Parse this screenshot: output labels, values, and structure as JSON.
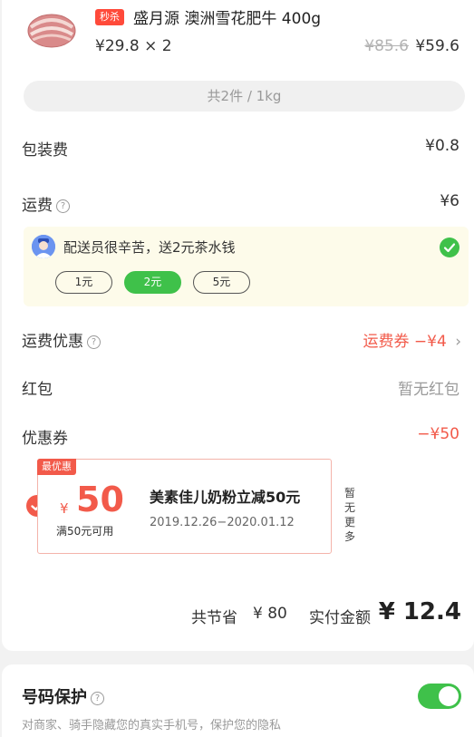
{
  "product": {
    "flash_tag": "秒杀",
    "name": "盛月源 澳洲雪花肥牛 400g",
    "unit_price": "¥29.8 × 2",
    "original_price": "¥85.6",
    "price": "¥59.6",
    "image_icon": "sliced-beef-image"
  },
  "summary": "共2件 / 1kg",
  "fees": {
    "packaging_label": "包装费",
    "packaging_value": "¥0.8",
    "delivery_label": "运费",
    "delivery_value": "¥6"
  },
  "tip": {
    "text": "配送员很辛苦，送2元茶水钱",
    "options": [
      "1元",
      "2元",
      "5元"
    ],
    "selected": "2元"
  },
  "delivery_discount": {
    "label": "运费优惠",
    "value": "运费券 −¥4"
  },
  "red_packet": {
    "label": "红包",
    "value": "暂无红包"
  },
  "coupon_row": {
    "label": "优惠券",
    "value": "−¥50"
  },
  "coupon": {
    "tag": "最优惠",
    "currency": "¥",
    "amount": "50",
    "condition": "满50元可用",
    "title": "美素佳儿奶粉立减50元",
    "dates": "2019.12.26−2020.01.12",
    "side_note": "暂无更多"
  },
  "footer": {
    "saved_label": "共节省",
    "saved_value": "¥ 80",
    "paid_label": "实付金额",
    "paid_value": "¥ 12.4"
  },
  "privacy": {
    "title": "号码保护",
    "desc": "对商家、骑手隐藏您的真实手机号，保护您的隐私",
    "enabled": true
  },
  "colors": {
    "accent_red": "#f25a4a",
    "accent_green": "#3fc14a",
    "tip_bg": "#fdfbea"
  }
}
